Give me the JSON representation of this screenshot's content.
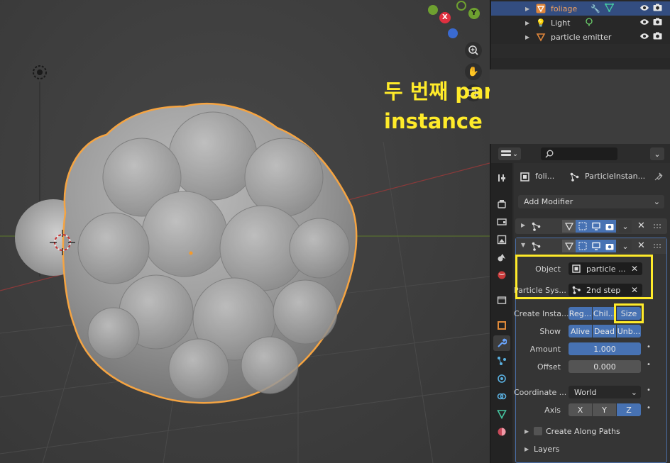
{
  "annotation": {
    "line1": "두 번째 particle",
    "line2": "instance modifier 추가"
  },
  "gizmo": {
    "x_label": "X",
    "y_label": "Y"
  },
  "outliner": {
    "items": [
      {
        "label": "foliage",
        "selected": true
      },
      {
        "label": "Light",
        "selected": false
      },
      {
        "label": "particle emitter",
        "selected": false
      }
    ]
  },
  "properties": {
    "breadcrumb_object": "foli...",
    "breadcrumb_modifier": "ParticleInstan...",
    "add_modifier": "Add Modifier",
    "modifier": {
      "object_label": "Object",
      "object_value": "particle ...",
      "psys_label": "Particle Sys...",
      "psys_value": "2nd step",
      "create_label": "Create Insta...",
      "create_options": [
        "Reg...",
        "Chil...",
        "Size"
      ],
      "show_label": "Show",
      "show_options": [
        "Alive",
        "Dead",
        "Unb..."
      ],
      "amount_label": "Amount",
      "amount_value": "1.000",
      "offset_label": "Offset",
      "offset_value": "0.000",
      "coord_label": "Coordinate ...",
      "coord_value": "World",
      "axis_label": "Axis",
      "axis_options": [
        "X",
        "Y",
        "Z"
      ],
      "create_paths_label": "Create Along Paths",
      "layers_label": "Layers"
    }
  },
  "colors": {
    "accent": "#4772b3",
    "highlight": "#ffeb2a",
    "selection_outline": "#f5a442"
  }
}
